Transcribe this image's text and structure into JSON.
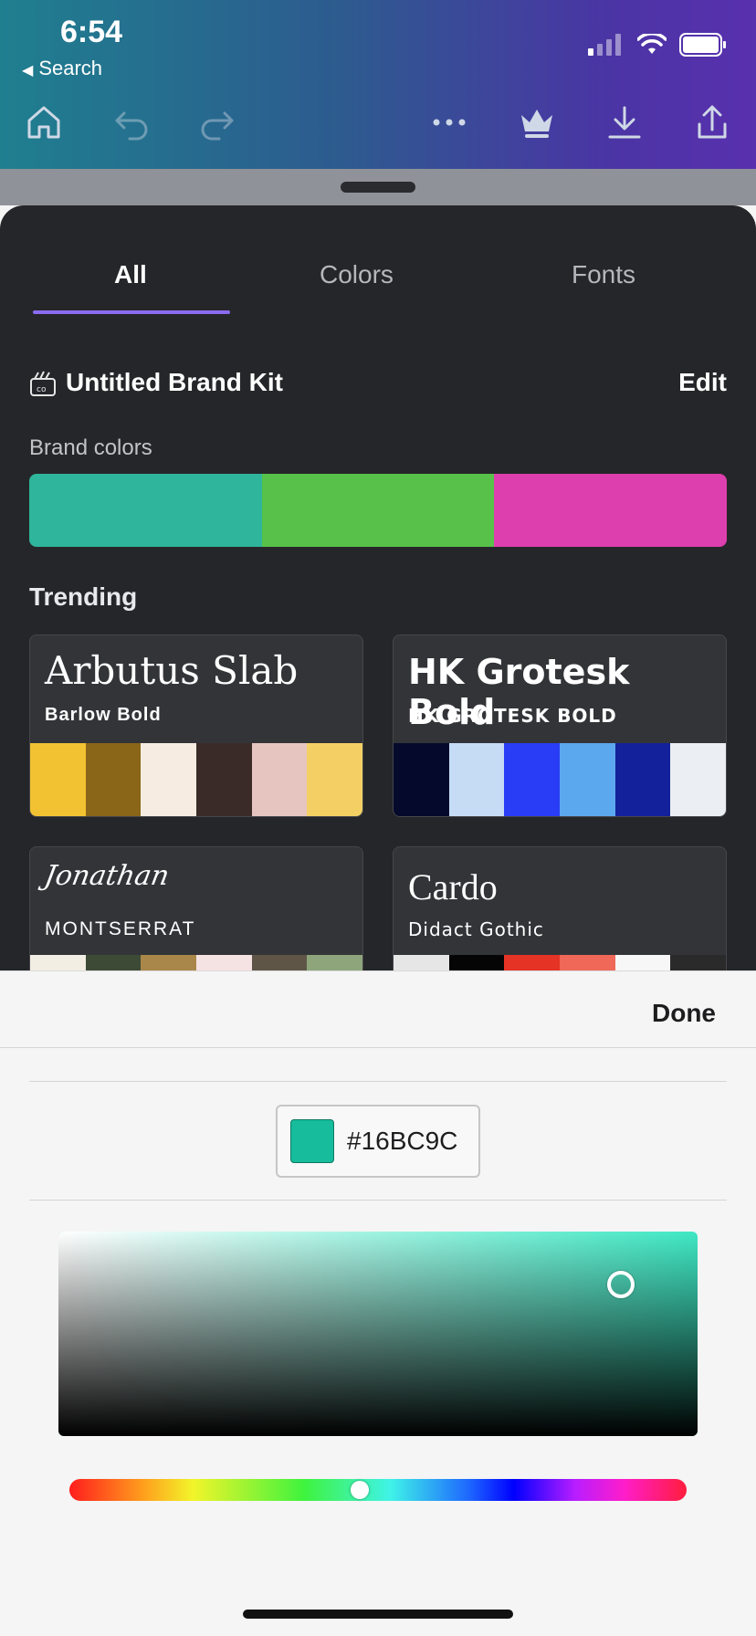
{
  "status": {
    "time": "6:54",
    "back_label": "Search"
  },
  "toolbar": {
    "icons": [
      "home-icon",
      "undo-icon",
      "redo-icon",
      "more-icon",
      "crown-icon",
      "download-icon",
      "share-icon"
    ]
  },
  "tabs": [
    {
      "label": "All",
      "active": true
    },
    {
      "label": "Colors",
      "active": false
    },
    {
      "label": "Fonts",
      "active": false
    }
  ],
  "brand_kit": {
    "title": "Untitled Brand Kit",
    "edit_label": "Edit",
    "brand_colors_label": "Brand colors",
    "colors": [
      "#2fb59b",
      "#58c14a",
      "#de3fae"
    ]
  },
  "trending": {
    "label": "Trending",
    "cards": [
      {
        "heading_font": "Arbutus Slab",
        "body_font": "Barlow Bold",
        "palette": [
          "#f2c233",
          "#8a6618",
          "#f7ece1",
          "#3a2b28",
          "#e6c5c0",
          "#f4d064"
        ]
      },
      {
        "heading_font": "HK Grotesk Bold",
        "body_font": "HK GROTESK BOLD",
        "palette": [
          "#050a2d",
          "#c6dcf5",
          "#2a3df6",
          "#5ba8ef",
          "#13229a",
          "#ebeef3"
        ]
      },
      {
        "heading_font": "Jonathan",
        "body_font": "MONTSERRAT",
        "palette": [
          "#f3eee4",
          "#3d4a36",
          "#a9874a",
          "#f5e2e2",
          "#5e5547",
          "#8ea57c"
        ]
      },
      {
        "heading_font": "Cardo",
        "body_font": "Didact Gothic",
        "palette": [
          "#e6e6e6",
          "#050505",
          "#e53326",
          "#ef6858",
          "#f7f7f7",
          "#2a2a2a"
        ]
      }
    ]
  },
  "picker": {
    "done_label": "Done",
    "hex_value": "#16BC9C",
    "swatch_color": "#16BC9C",
    "hue_color": "#3fe8c4",
    "saturation": 0.88,
    "brightness": 0.74,
    "hue_fraction": 0.47
  }
}
